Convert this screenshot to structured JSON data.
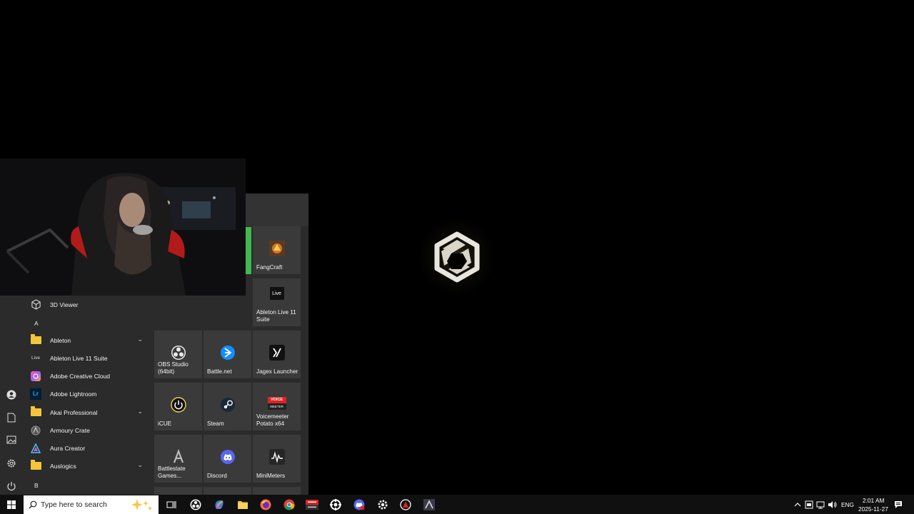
{
  "start_menu": {
    "app_list": [
      {
        "type": "app",
        "label": "3D Viewer",
        "icon": "cube-icon"
      },
      {
        "type": "letter",
        "label": "A"
      },
      {
        "type": "folder",
        "label": "Ableton",
        "expandable": true
      },
      {
        "type": "app",
        "label": "Ableton Live 11 Suite",
        "icon": "live-icon",
        "icon_text": "Live"
      },
      {
        "type": "app",
        "label": "Adobe Creative Cloud",
        "icon": "creative-cloud-icon"
      },
      {
        "type": "app",
        "label": "Adobe Lightroom",
        "icon": "lightroom-icon",
        "icon_text": "Lr"
      },
      {
        "type": "folder",
        "label": "Akai Professional",
        "expandable": true
      },
      {
        "type": "app",
        "label": "Armoury Crate",
        "icon": "armoury-crate-icon"
      },
      {
        "type": "app",
        "label": "Aura Creator",
        "icon": "aura-creator-icon"
      },
      {
        "type": "folder",
        "label": "Auslogics",
        "expandable": true
      },
      {
        "type": "letter",
        "label": "B"
      }
    ],
    "tiles": {
      "fangcraft": "FangCraft",
      "ableton": "Ableton Live 11 Suite",
      "ableton_icon_text": "Live",
      "obs": "OBS Studio (64bit)",
      "battlenet": "Battle.net",
      "jagex": "Jagex Launcher",
      "icue": "iCUE",
      "steam": "Steam",
      "voicemeeter": "Voicemeeter Potato x64",
      "voicemeeter_icon_text_1": "VOICE",
      "voicemeeter_icon_text_2": "MEETER",
      "battlestate": "Battlestate Games...",
      "discord": "Discord",
      "minimeters": "MiniMeters"
    }
  },
  "taskbar": {
    "search_placeholder": "Type here to search",
    "apps": [
      "task-view-icon",
      "obs-icon",
      "copilot-icon",
      "file-explorer-icon",
      "firefox-icon",
      "chrome-icon",
      "voicemeeter-icon",
      "steam-icon",
      "discord-icon",
      "settings-icon",
      "armoury-crate-icon",
      "battlestate-icon"
    ],
    "tray": {
      "language": "ENG",
      "time": "2:01 AM",
      "date": "2025-11-27"
    }
  },
  "colors": {
    "menu_bg": "#2b2b2b",
    "tile_bg": "#3a3a3a",
    "accent_green": "#3fb950",
    "taskbar_bg": "#101010"
  }
}
